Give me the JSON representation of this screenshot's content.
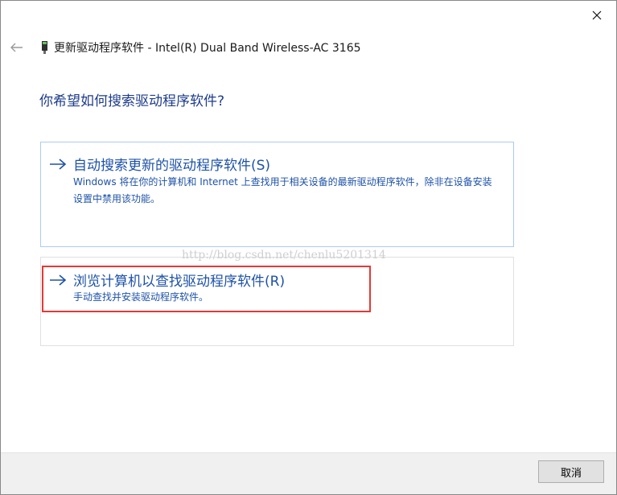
{
  "window": {
    "title": "更新驱动程序软件 - Intel(R) Dual Band Wireless-AC 3165",
    "close_icon": "close-icon",
    "back_icon": "back-arrow-icon",
    "device_icon": "network-adapter-icon"
  },
  "main": {
    "question": "你希望如何搜索驱动程序软件?",
    "options": [
      {
        "icon": "arrow-right-icon",
        "title": "自动搜索更新的驱动程序软件(S)",
        "description": "Windows 将在你的计算机和 Internet 上查找用于相关设备的最新驱动程序软件，除非在设备安装设置中禁用该功能。"
      },
      {
        "icon": "arrow-right-icon",
        "title": "浏览计算机以查找驱动程序软件(R)",
        "description": "手动查找并安装驱动程序软件。"
      }
    ],
    "watermark": "http://blog.csdn.net/chenlu5201314"
  },
  "footer": {
    "cancel_label": "取消"
  },
  "colors": {
    "link_blue": "#1e52a8",
    "heading_blue": "#1e3c8c",
    "highlight_red": "#e53935",
    "selected_border": "#a9cdee"
  }
}
